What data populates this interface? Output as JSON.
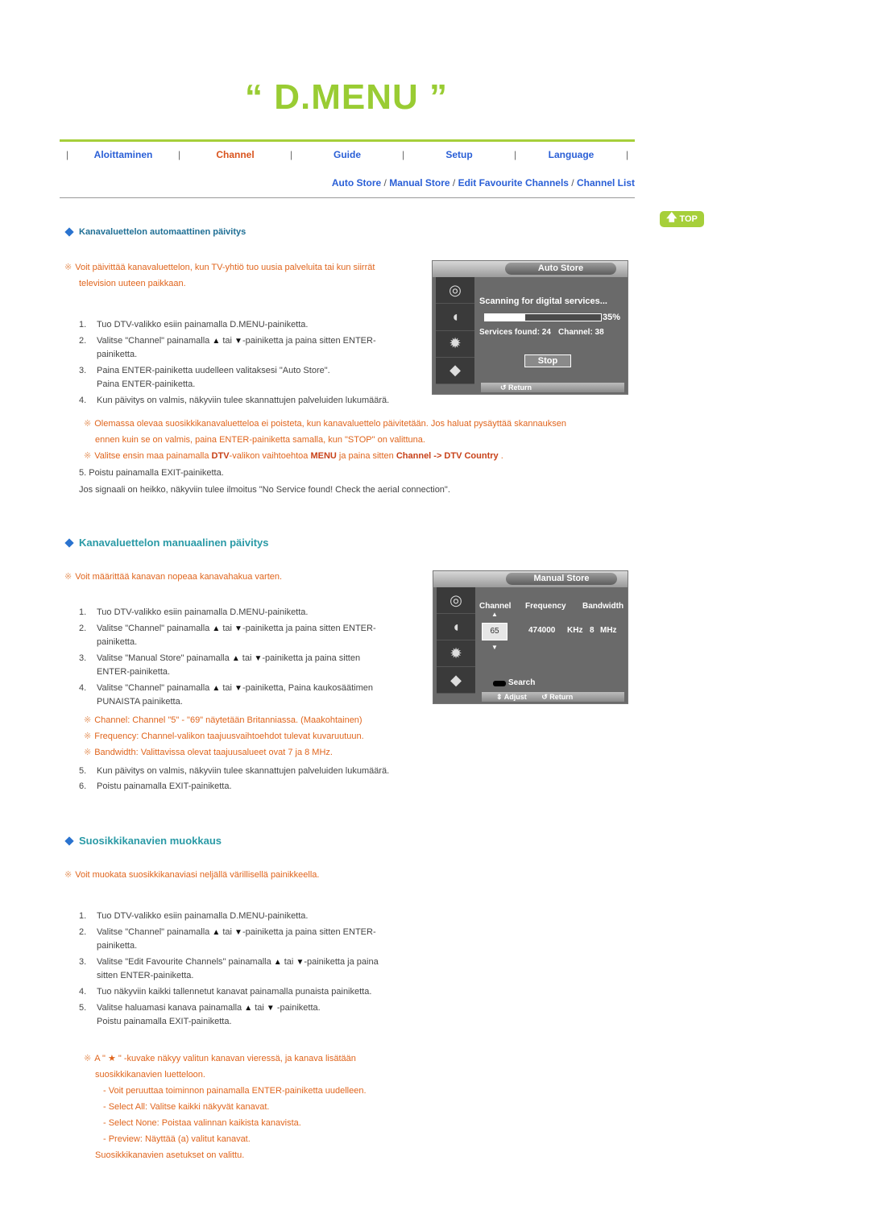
{
  "header": {
    "title": "“ D.MENU ”"
  },
  "nav": {
    "items": [
      {
        "label": "Aloittaminen",
        "active": false
      },
      {
        "label": "Channel",
        "active": true
      },
      {
        "label": "Guide",
        "active": false
      },
      {
        "label": "Setup",
        "active": false
      },
      {
        "label": "Language",
        "active": false
      }
    ],
    "subnav": [
      "Auto Store",
      "Manual Store",
      "Edit Favourite Channels",
      "Channel List"
    ],
    "separator": "/"
  },
  "top_button": {
    "label": "TOP",
    "icon": "arrow-up-icon"
  },
  "colors": {
    "accent_green": "#a6cf3a",
    "link_blue": "#2a5fd6",
    "active_orange": "#d9541e",
    "note_orange": "#e0651d",
    "heading_teal": "#2a9aa6"
  },
  "note_mark": "※",
  "sections": {
    "auto": {
      "heading": "Kanavaluettelon automaattinen päivitys",
      "intro": [
        "Voit päivittää kanavaluettelon, kun TV-yhtiö tuo uusia palveluita tai kun siirrät",
        "television uuteen paikkaan."
      ],
      "steps": [
        {
          "n": "1.",
          "text": "Tuo DTV-valikko esiin painamalla D.MENU-painiketta."
        },
        {
          "n": "2.",
          "pre": "Valitse \"Channel\" painamalla",
          "mid": "tai",
          "post": "-painiketta ja paina sitten ENTER-",
          "cont": "painiketta."
        },
        {
          "n": "3.",
          "text": "Paina ENTER-painiketta uudelleen valitaksesi \"Auto Store\".",
          "cont": "Paina ENTER-painiketta."
        },
        {
          "n": "4.",
          "text": "Kun päivitys on valmis, näkyviin tulee skannattujen palveluiden lukumäärä."
        }
      ],
      "notes": [
        [
          "Olemassa olevaa suosikkikanavaluetteloa ei poisteta, kun kanavaluettelo päivitetään. Jos haluat pysäyttää skannauksen",
          "ennen kuin se on valmis, paina ENTER-painiketta samalla, kun \"STOP\" on valittuna."
        ],
        {
          "a": "Valitse ensin maa painamalla ",
          "b1": "DTV",
          "c": "-valikon vaihtoehtoa ",
          "b2": "MENU",
          "d": " ja paina sitten ",
          "b3": "Channel -> DTV Country",
          "e": " ."
        }
      ],
      "step5": "5. Poistu painamalla EXIT-painiketta.",
      "weak_signal": "Jos signaali on heikko, näkyviin tulee ilmoitus \"No Service found! Check the aerial connection\".",
      "screen": {
        "title": "Auto Store",
        "scanning": "Scanning for digital services...",
        "progress_percent": 35,
        "progress_label": "35%",
        "services_found": "Services found: 24",
        "channel": "Channel: 38",
        "stop_label": "Stop",
        "return_label": "↺ Return"
      }
    },
    "manual": {
      "heading": "Kanavaluettelon manuaalinen päivitys",
      "intro": "Voit määrittää kanavan nopeaa kanavahakua varten.",
      "steps": [
        {
          "n": "1.",
          "text": "Tuo DTV-valikko esiin painamalla D.MENU-painiketta."
        },
        {
          "n": "2.",
          "pre": "Valitse \"Channel\" painamalla",
          "mid": "tai",
          "post": "-painiketta ja paina sitten ENTER-",
          "cont": "painiketta."
        },
        {
          "n": "3.",
          "pre": "Valitse \"Manual Store\" painamalla",
          "mid": "tai",
          "post": "-painiketta ja paina sitten",
          "cont": "ENTER-painiketta."
        },
        {
          "n": "4.",
          "pre": "Valitse \"Channel\" painamalla",
          "mid": "tai",
          "post": "-painiketta, Paina kaukosäätimen",
          "cont": "PUNAISTA painiketta."
        }
      ],
      "notes": [
        "Channel: Channel \"5\" - \"69\" näytetään Britanniassa. (Maakohtainen)",
        "Frequency: Channel-valikon taajuusvaihtoehdot tulevat kuvaruutuun.",
        "Bandwidth: Valittavissa olevat taajuusalueet ovat 7 ja 8 MHz."
      ],
      "steps2": [
        {
          "n": "5.",
          "text": "Kun päivitys on valmis, näkyviin tulee skannattujen palveluiden lukumäärä."
        },
        {
          "n": "6.",
          "text": "Poistu painamalla EXIT-painiketta."
        }
      ],
      "screen": {
        "title": "Manual Store",
        "col_channel": "Channel",
        "col_frequency": "Frequency",
        "col_bandwidth": "Bandwidth",
        "channel_value": "65",
        "frequency_value": "474000",
        "frequency_unit": "KHz",
        "bandwidth_value": "8",
        "bandwidth_unit": "MHz",
        "search_label": "Search",
        "adjust_label": "⇕ Adjust",
        "return_label": "↺ Return"
      }
    },
    "fav": {
      "heading": "Suosikkikanavien muokkaus",
      "intro": "Voit muokata suosikkikanaviasi neljällä värillisellä painikkeella.",
      "steps": [
        {
          "n": "1.",
          "text": "Tuo DTV-valikko esiin painamalla D.MENU-painiketta."
        },
        {
          "n": "2.",
          "pre": "Valitse \"Channel\" painamalla",
          "mid": "tai",
          "post": "-painiketta ja paina sitten ENTER-",
          "cont": "painiketta."
        },
        {
          "n": "3.",
          "pre": "Valitse \"Edit Favourite Channels\" painamalla",
          "mid": "tai",
          "post": "-painiketta ja paina",
          "cont": "sitten ENTER-painiketta."
        },
        {
          "n": "4.",
          "text": "Tuo näkyviin kaikki tallennetut kanavat painamalla punaista painiketta."
        },
        {
          "n": "5.",
          "pre": "Valitse haluamasi kanava painamalla",
          "mid": "tai",
          "post": " -painiketta.",
          "cont": "Poistu painamalla EXIT-painiketta."
        }
      ],
      "star_note": {
        "a": "A \"",
        "b": "\" -kuvake näkyy valitun kanavan vieressä, ja kanava lisätään",
        "cont": "suosikkikanavien luetteloon."
      },
      "dash_items": [
        "- Voit peruuttaa toiminnon painamalla ENTER-painiketta uudelleen.",
        "- Select All: Valitse kaikki näkyvät kanavat.",
        "- Select None: Poistaa valinnan kaikista kanavista.",
        "- Preview: Näyttää (a) valitut kanavat."
      ],
      "final": "Suosikkikanavien asetukset on valittu."
    }
  }
}
